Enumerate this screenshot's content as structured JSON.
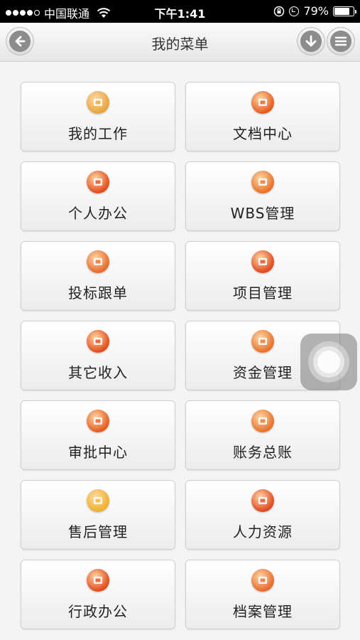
{
  "status_bar": {
    "carrier": "中国联通",
    "time": "下午1:41",
    "battery": "79%",
    "battery_level": 0.79
  },
  "nav": {
    "title": "我的菜单"
  },
  "menu": {
    "items": [
      {
        "label": "我的工作",
        "icon": "user-desk-icon",
        "color": "#e8a33a"
      },
      {
        "label": "文档中心",
        "icon": "document-icon",
        "color": "#e65a1e"
      },
      {
        "label": "个人办公",
        "icon": "office-icon",
        "color": "#e24a1a"
      },
      {
        "label": "WBS管理",
        "icon": "wbs-icon",
        "color": "#e8702a"
      },
      {
        "label": "投标跟单",
        "icon": "briefcase-icon",
        "color": "#e8692b"
      },
      {
        "label": "项目管理",
        "icon": "flag-icon",
        "color": "#e0481d"
      },
      {
        "label": "其它收入",
        "icon": "income-icon",
        "color": "#e24a1a"
      },
      {
        "label": "资金管理",
        "icon": "fund-icon",
        "color": "#e8702a"
      },
      {
        "label": "审批中心",
        "icon": "approval-icon",
        "color": "#e65a1e"
      },
      {
        "label": "账务总账",
        "icon": "ledger-icon",
        "color": "#e8702a"
      },
      {
        "label": "售后管理",
        "icon": "aftersales-icon",
        "color": "#f0b02a"
      },
      {
        "label": "人力资源",
        "icon": "people-icon",
        "color": "#e0481d"
      },
      {
        "label": "行政办公",
        "icon": "admin-icon",
        "color": "#e24a1a"
      },
      {
        "label": "档案管理",
        "icon": "archive-icon",
        "color": "#e8692b"
      }
    ]
  }
}
